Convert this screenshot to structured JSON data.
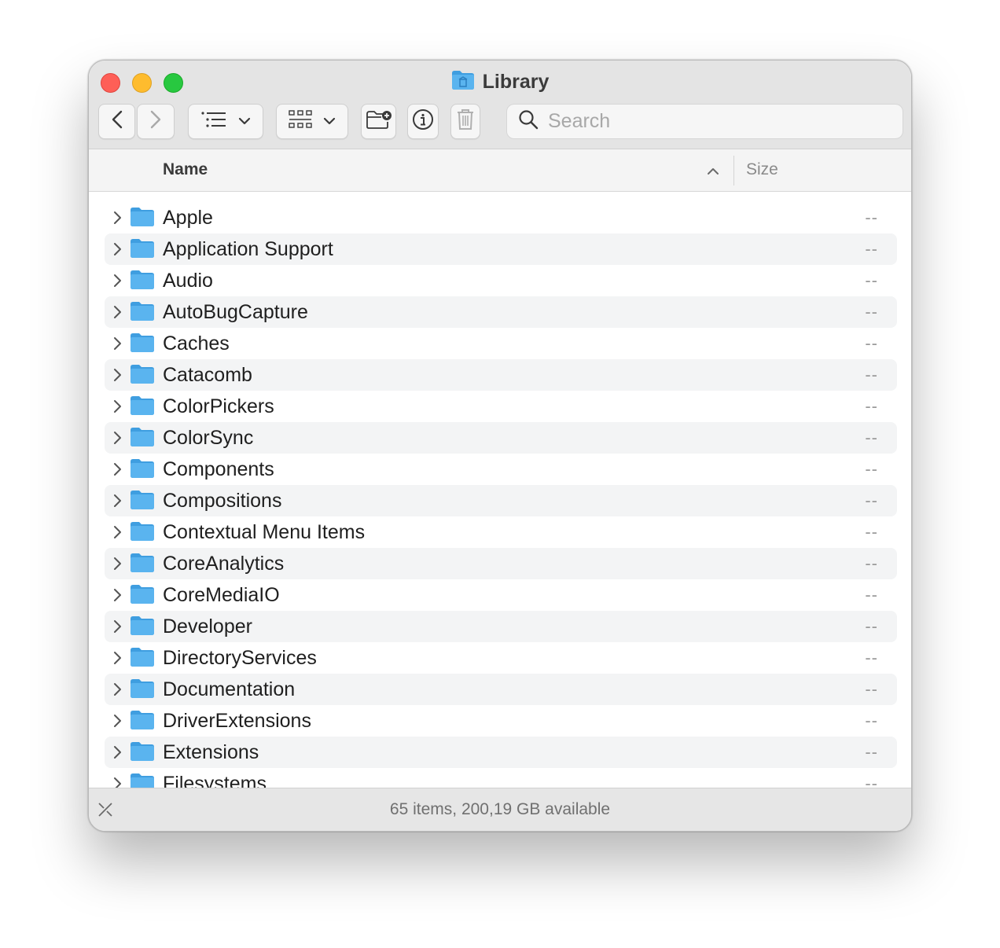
{
  "window": {
    "title": "Library",
    "search": {
      "placeholder": "Search",
      "value": ""
    }
  },
  "toolbar": {
    "icons": [
      "chevron-left-icon",
      "chevron-right-icon",
      "list-view-icon",
      "chevron-down-icon",
      "grid-view-icon",
      "chevron-down-icon",
      "new-folder-icon",
      "info-icon",
      "trash-icon",
      "search-icon"
    ]
  },
  "columns": {
    "name": "Name",
    "size": "Size",
    "sort": "ascending"
  },
  "items": [
    {
      "name": "Apple",
      "size": "--"
    },
    {
      "name": "Application Support",
      "size": "--"
    },
    {
      "name": "Audio",
      "size": "--"
    },
    {
      "name": "AutoBugCapture",
      "size": "--"
    },
    {
      "name": "Caches",
      "size": "--"
    },
    {
      "name": "Catacomb",
      "size": "--"
    },
    {
      "name": "ColorPickers",
      "size": "--"
    },
    {
      "name": "ColorSync",
      "size": "--"
    },
    {
      "name": "Components",
      "size": "--"
    },
    {
      "name": "Compositions",
      "size": "--"
    },
    {
      "name": "Contextual Menu Items",
      "size": "--"
    },
    {
      "name": "CoreAnalytics",
      "size": "--"
    },
    {
      "name": "CoreMediaIO",
      "size": "--"
    },
    {
      "name": "Developer",
      "size": "--"
    },
    {
      "name": "DirectoryServices",
      "size": "--"
    },
    {
      "name": "Documentation",
      "size": "--"
    },
    {
      "name": "DriverExtensions",
      "size": "--"
    },
    {
      "name": "Extensions",
      "size": "--"
    },
    {
      "name": "Filesystems",
      "size": "--"
    }
  ],
  "status": {
    "text": "65 items, 200,19 GB available"
  },
  "colors": {
    "folder": "#5ab4ef",
    "folder_tab": "#3f9ee0",
    "row_alt": "#f3f4f5",
    "toolbar_bg": "#e4e4e4"
  }
}
